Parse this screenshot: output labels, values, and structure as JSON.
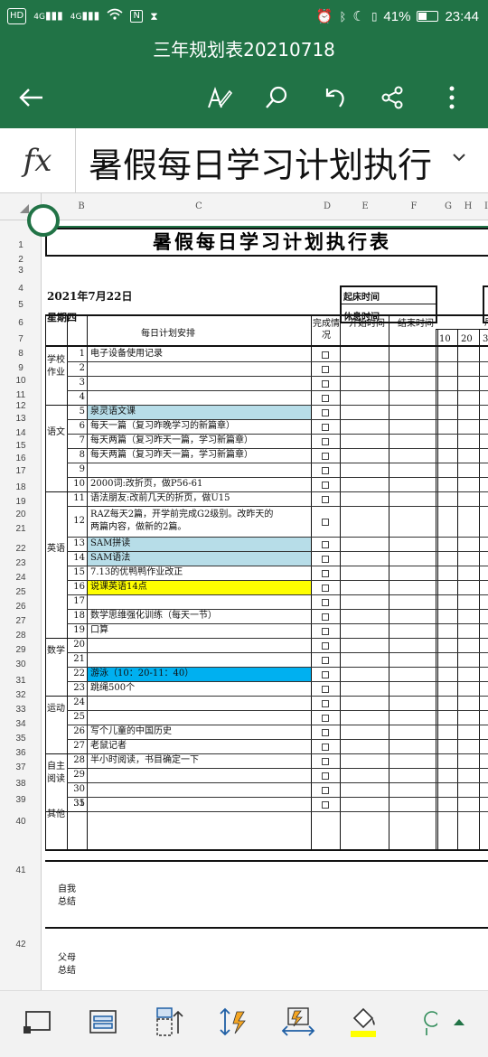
{
  "status": {
    "left_badges": [
      "HD",
      "4G",
      "4G"
    ],
    "battery": "41%",
    "time": "23:44"
  },
  "title": "三年规划表20210718",
  "formula": "暑假每日学习计划执行",
  "columns": [
    "B",
    "C",
    "D",
    "E",
    "F",
    "G",
    "H",
    "I"
  ],
  "rows": [
    "1",
    "2",
    "3",
    "4",
    "5",
    "6",
    "7",
    "8",
    "9",
    "10",
    "11",
    "12",
    "13",
    "14",
    "15",
    "16",
    "17",
    "18",
    "19",
    "20",
    "21",
    "22",
    "23",
    "24",
    "25",
    "26",
    "27",
    "28",
    "29",
    "30",
    "31",
    "32",
    "33",
    "34",
    "35",
    "36",
    "37",
    "38",
    "39",
    "40",
    "41",
    "42"
  ],
  "sheet": {
    "heading": "暑假每日学习计划执行表",
    "date": "2021年7月22日",
    "weekday": "星期四",
    "wake_label": "起床时间",
    "rest_label": "休息时间",
    "plan_header": "每日计划安排",
    "done_header": "完成情况",
    "start_header": "开始时间",
    "end_header": "结束时间",
    "min_labels": [
      "10",
      "20",
      "3"
    ],
    "h_label": "用",
    "categories": {
      "school": "学校作业",
      "chinese": "语文",
      "english": "英语",
      "math": "数学",
      "sport": "运动",
      "reading": "自主阅读",
      "other": "其他"
    },
    "items": [
      {
        "n": "1",
        "text": "电子设备使用记录"
      },
      {
        "n": "2",
        "text": ""
      },
      {
        "n": "3",
        "text": ""
      },
      {
        "n": "4",
        "text": ""
      },
      {
        "n": "5",
        "text": "泉灵语文课"
      },
      {
        "n": "6",
        "text": "每天一篇（复习昨晚学习的新篇章）"
      },
      {
        "n": "7",
        "text": "每天两篇（复习昨天一篇，学习新篇章）"
      },
      {
        "n": "8",
        "text": "每天两篇（复习昨天一篇，学习新篇章）"
      },
      {
        "n": "9",
        "text": ""
      },
      {
        "n": "10",
        "text": "2000词:改折页，做P56-61"
      },
      {
        "n": "11",
        "text": "语法朋友:改前几天的折页，做U15"
      },
      {
        "n": "12",
        "text": "RAZ每天2篇，开学前完成G2级别。改昨天的",
        "text2": "两篇内容，做新的2篇。"
      },
      {
        "n": "13",
        "text": "SAM拼读"
      },
      {
        "n": "14",
        "text": "SAM语法"
      },
      {
        "n": "15",
        "text": "7.13的优鸭鸭作业改正"
      },
      {
        "n": "16",
        "text": "说课英语14点"
      },
      {
        "n": "17",
        "text": ""
      },
      {
        "n": "18",
        "text": "数学思维强化训练（每天一节）"
      },
      {
        "n": "19",
        "text": "口算"
      },
      {
        "n": "20",
        "text": ""
      },
      {
        "n": "21",
        "text": ""
      },
      {
        "n": "22",
        "text": "游泳（10：20-11：40）"
      },
      {
        "n": "23",
        "text": "跳绳500个"
      },
      {
        "n": "24",
        "text": ""
      },
      {
        "n": "25",
        "text": ""
      },
      {
        "n": "26",
        "text": "写个儿童的中国历史"
      },
      {
        "n": "27",
        "text": "老鼠记者"
      },
      {
        "n": "28",
        "text": "半小时阅读，书目确定一下"
      },
      {
        "n": "29",
        "text": ""
      },
      {
        "n": "30",
        "text": ""
      },
      {
        "n": "31",
        "text": ""
      },
      {
        "n": "35",
        "text": ""
      }
    ],
    "self_summary": "自我总结",
    "parent_summary": "父母总结"
  },
  "colors": {
    "brand": "#217346",
    "blue_fill": "#b7dde8",
    "yellow_fill": "#ffff00",
    "bright_blue_fill": "#00b0f0"
  }
}
